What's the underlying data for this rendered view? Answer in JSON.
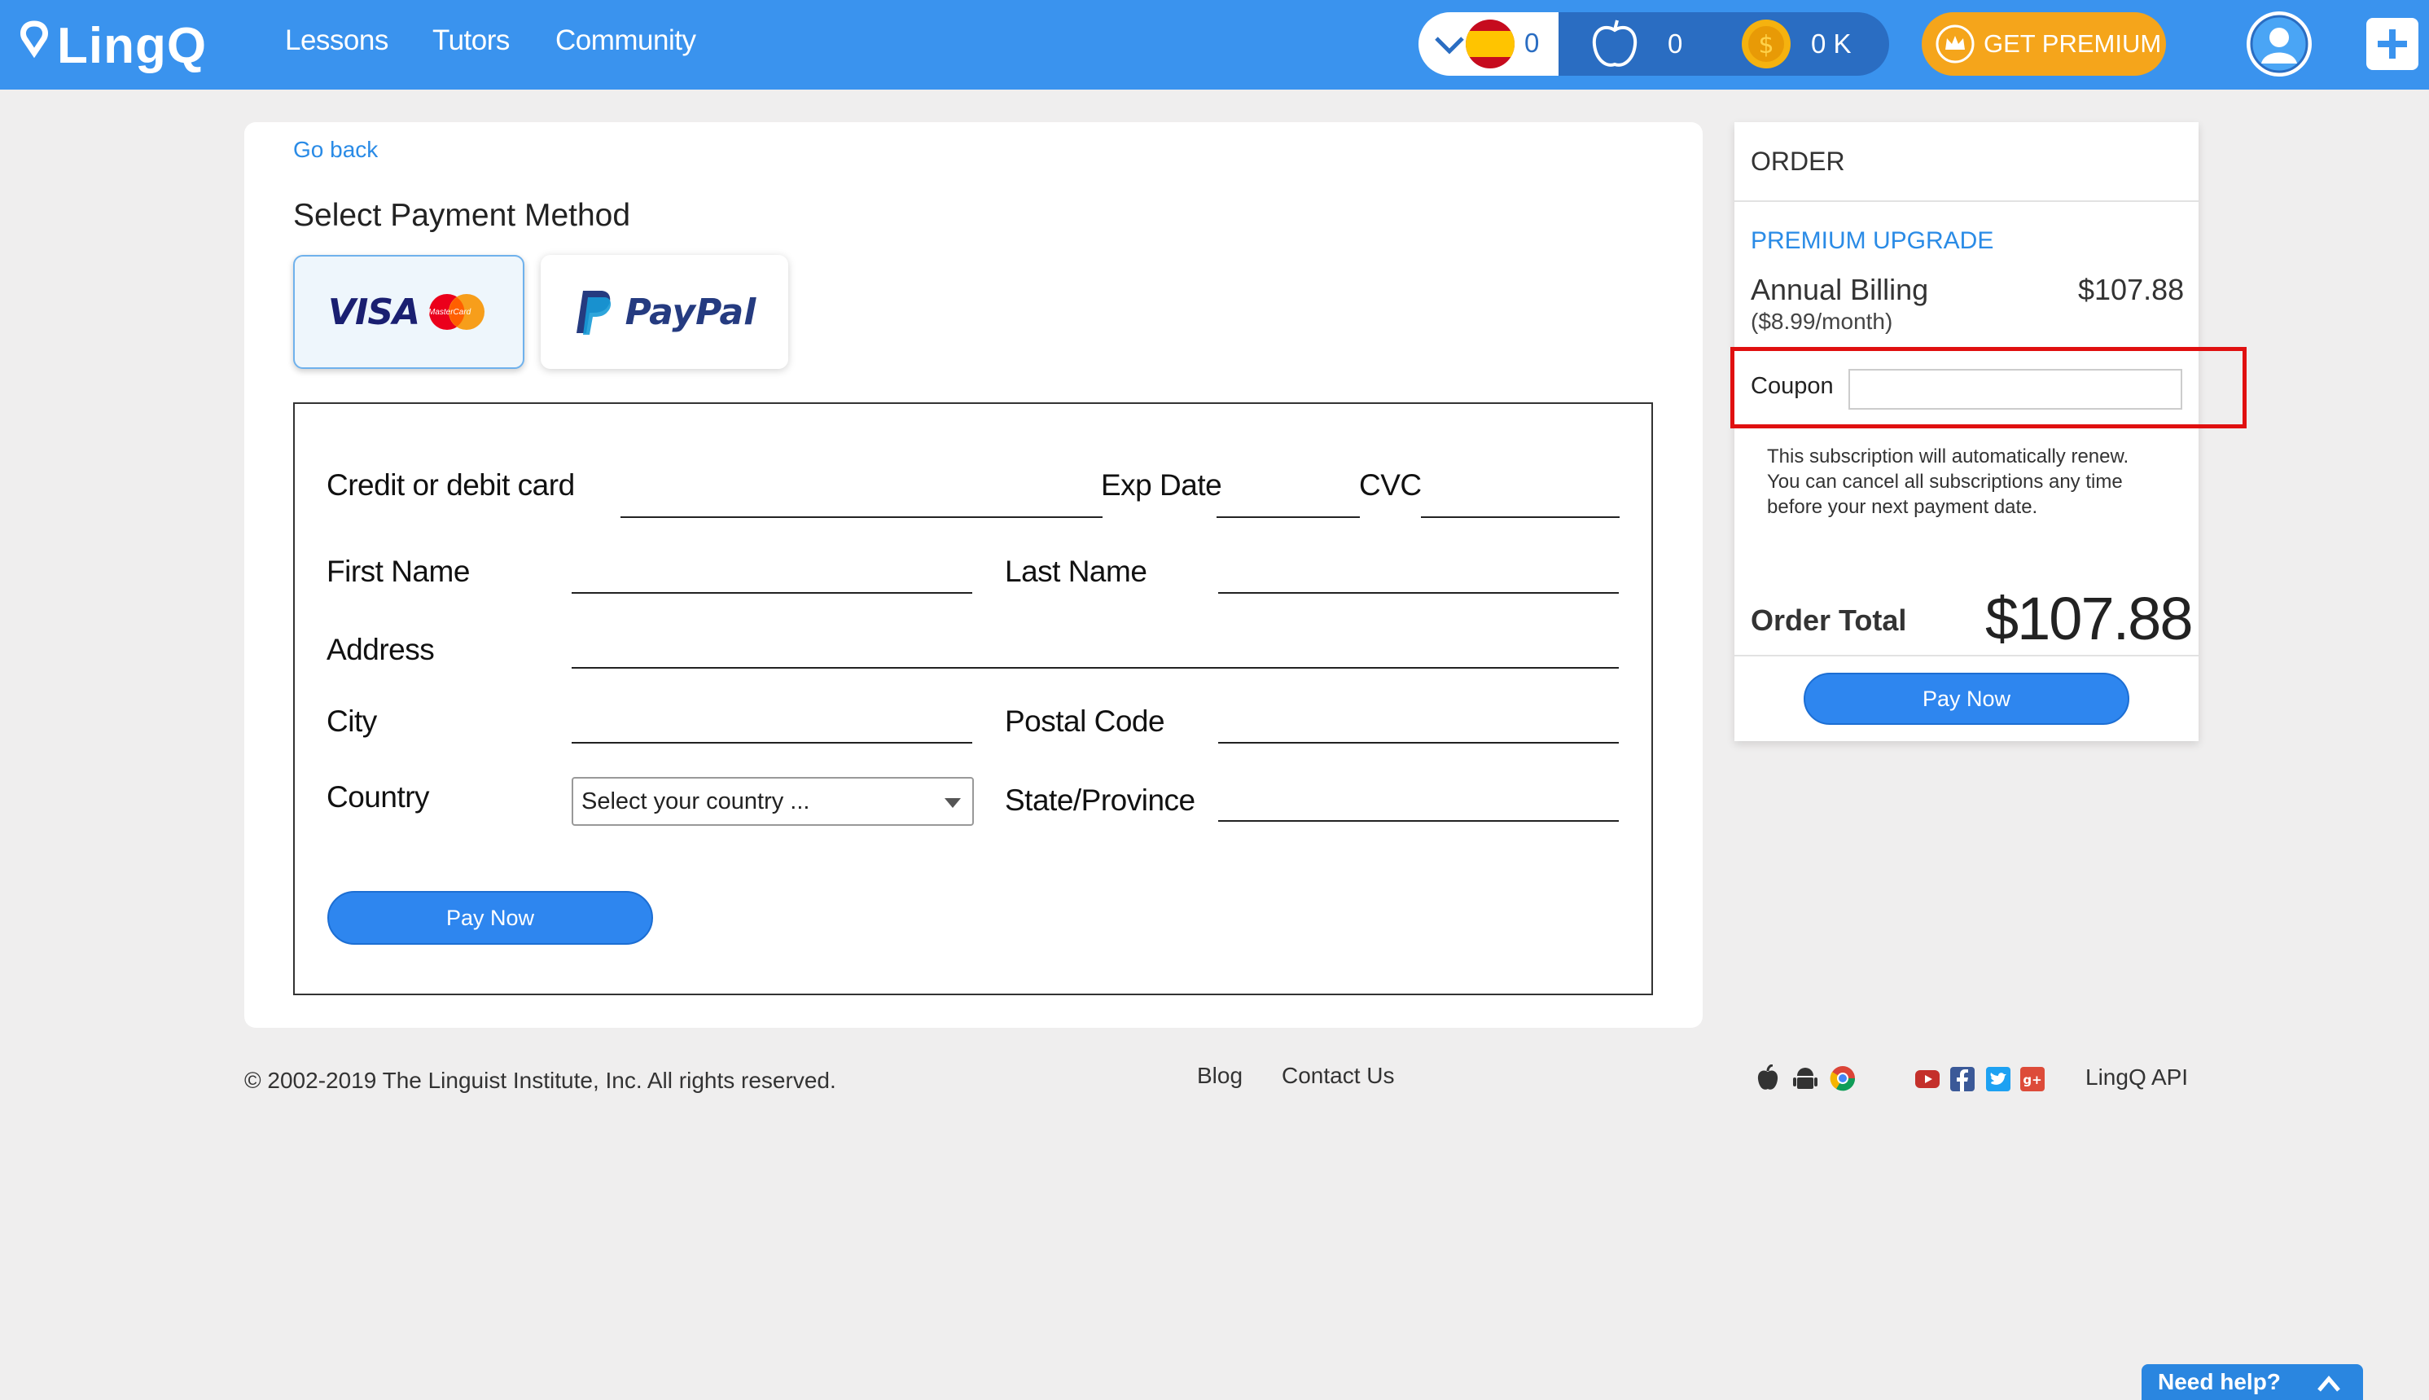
{
  "header": {
    "logo_text": "LingQ",
    "nav": [
      "Lessons",
      "Tutors",
      "Community"
    ],
    "language_count": "0",
    "apples_count": "0",
    "coins_count": "0 K",
    "premium_label": "GET PREMIUM"
  },
  "payment": {
    "go_back": "Go back",
    "title": "Select Payment Method",
    "methods": [
      "VISA",
      "PayPal"
    ],
    "mastercard_text": "MasterCard",
    "labels": {
      "card": "Credit or debit card",
      "exp": "Exp Date",
      "cvc": "CVC",
      "first": "First Name",
      "last": "Last Name",
      "address": "Address",
      "city": "City",
      "postal": "Postal Code",
      "country": "Country",
      "state": "State/Province"
    },
    "country_placeholder": "Select your country ...",
    "pay_now": "Pay Now"
  },
  "order": {
    "heading": "ORDER",
    "product": "PREMIUM UPGRADE",
    "billing": "Annual Billing",
    "per_month": "($8.99/month)",
    "price": "$107.88",
    "coupon_label": "Coupon",
    "coupon_value": "",
    "renew_note": [
      "This subscription will automatically renew.",
      "You can cancel all subscriptions any time",
      "before your next payment date."
    ],
    "total_label": "Order Total",
    "total_value": "$107.88",
    "pay_now": "Pay Now"
  },
  "footer": {
    "copyright": "© 2002-2019 The Linguist Institute, Inc. All rights reserved.",
    "blog": "Blog",
    "contact": "Contact Us",
    "api": "LingQ API",
    "need_help": "Need help?"
  },
  "colors": {
    "brand_blue": "#3a93ee",
    "premium_orange": "#f5a51b",
    "highlight_red": "#e01010"
  }
}
